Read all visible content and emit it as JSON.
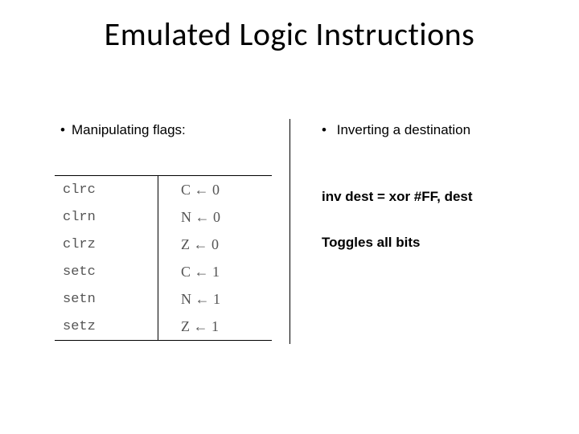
{
  "title": "Emulated Logic Instructions",
  "left": {
    "heading_bullet": "•",
    "heading": "Manipulating flags:"
  },
  "right": {
    "heading_bullet": "•",
    "heading": "Inverting a destination"
  },
  "equation": "inv  dest  =   xor  #FF, dest",
  "note": "Toggles  all bits",
  "table": {
    "rows": [
      {
        "mnemonic": "clrc",
        "effect": "C ← 0"
      },
      {
        "mnemonic": "clrn",
        "effect": "N ← 0"
      },
      {
        "mnemonic": "clrz",
        "effect": "Z ← 0"
      },
      {
        "mnemonic": "setc",
        "effect": "C ← 1"
      },
      {
        "mnemonic": "setn",
        "effect": "N ← 1"
      },
      {
        "mnemonic": "setz",
        "effect": "Z ← 1"
      }
    ]
  }
}
